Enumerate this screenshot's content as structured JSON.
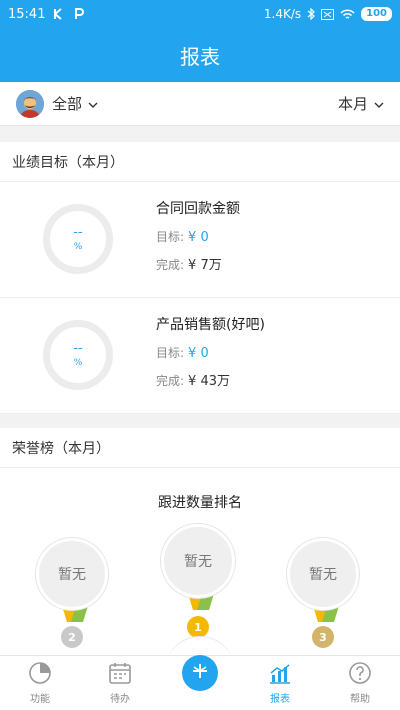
{
  "status_bar": {
    "time": "15:41",
    "net_speed": "1.4K/s",
    "battery": "100"
  },
  "header": {
    "title": "报表"
  },
  "filter": {
    "scope_label": "全部",
    "period_label": "本月"
  },
  "targets": {
    "section_title": "业绩目标（本月）",
    "cards": [
      {
        "title": "合同回款金额",
        "ring_value": "--",
        "ring_unit": "%",
        "target_label": "目标:",
        "target_value": "¥ 0",
        "done_label": "完成:",
        "done_value": "¥ 7万"
      },
      {
        "title": "产品销售额(好吧)",
        "ring_value": "--",
        "ring_unit": "%",
        "target_label": "目标:",
        "target_value": "¥ 0",
        "done_label": "完成:",
        "done_value": "¥ 43万"
      }
    ]
  },
  "honor": {
    "section_title": "荣誉榜（本月）",
    "ranking_title": "跟进数量排名",
    "medals": [
      {
        "text": "暂无",
        "rank": "2"
      },
      {
        "text": "暂无",
        "rank": "1"
      },
      {
        "text": "暂无",
        "rank": "3"
      }
    ]
  },
  "tabs": [
    {
      "label": "功能",
      "icon": "pie-chart-icon"
    },
    {
      "label": "待办",
      "icon": "calendar-icon"
    },
    {
      "label": "",
      "icon": "plus-icon"
    },
    {
      "label": "报表",
      "icon": "bar-chart-icon"
    },
    {
      "label": "帮助",
      "icon": "help-icon"
    }
  ],
  "colors": {
    "accent": "#22a4ee",
    "gold": "#f5b800",
    "silver": "#c9c9c9",
    "bronze": "#d4b36a"
  }
}
